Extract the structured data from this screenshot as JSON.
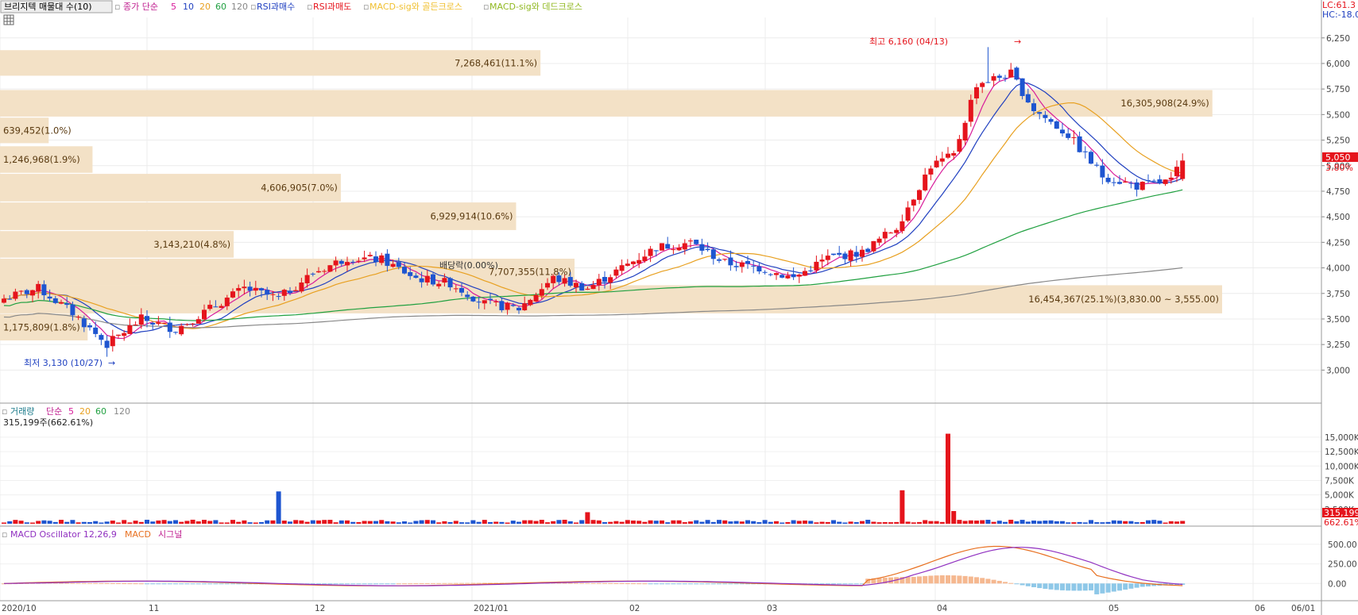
{
  "header": {
    "indicator_button": "브리지텍 매물대 수(10)",
    "ma_label": "종가 단순",
    "ma_periods": [
      "5",
      "10",
      "20",
      "60",
      "120"
    ],
    "rsi_buy": "RSI과매수",
    "rsi_sell": "RSI과매도",
    "macd_golden": "MACD-sig와 골든크로스",
    "macd_dead": "MACD-sig와 데드크로스",
    "lc": "LC:61.3",
    "hc": "HC:-18.0"
  },
  "volume_header": {
    "title": "거래량",
    "ma_label": "단순",
    "periods": [
      "5",
      "20",
      "60",
      "120"
    ],
    "current": "315,199주(662.61%)"
  },
  "macd_header": {
    "title": "MACD Oscillator 12,26,9",
    "macd": "MACD",
    "signal": "시그널"
  },
  "price_badge": {
    "price": "5,050",
    "change": "3.80%"
  },
  "volume_badge": {
    "value": "315,199",
    "pct": "662.61%"
  },
  "annotations": {
    "high": "최고 6,160 (04/13)",
    "low": "최저 3,130 (10/27)",
    "dividend": "배당락(0.00%)"
  },
  "colors": {
    "up": "#e5141c",
    "down": "#1e55d0",
    "ma5": "#d81b9a",
    "ma10": "#2040c0",
    "ma20": "#e8a020",
    "ma60": "#20a040",
    "ma120": "#888888",
    "profile": "#f3e1c6"
  },
  "chart_data": [
    {
      "type": "candlestick",
      "title": "",
      "ylim": [
        2700,
        6450
      ],
      "y_ticks": [
        "3,000",
        "3,250",
        "3,500",
        "3,750",
        "4,000",
        "4,250",
        "4,500",
        "4,750",
        "5,000",
        "5,250",
        "5,500",
        "5,750",
        "6,000",
        "6,250"
      ],
      "x_tick_labels": [
        "2020/10",
        "11",
        "12",
        "2021/01",
        "02",
        "03",
        "04",
        "05",
        "06",
        "06/01"
      ],
      "last_close": 5050,
      "high": 6160,
      "low": 3130,
      "volume_profile": [
        {
          "label": "7,268,461(11.1%)",
          "from": 5880,
          "to": 6130
        },
        {
          "label": "16,305,908(24.9%)",
          "from": 5480,
          "to": 5740
        },
        {
          "label": "639,452(1.0%)",
          "from": 5220,
          "to": 5470
        },
        {
          "label": "1,246,968(1.9%)",
          "from": 4930,
          "to": 5190
        },
        {
          "label": "4,606,905(7.0%)",
          "from": 4650,
          "to": 4920
        },
        {
          "label": "6,929,914(10.6%)",
          "from": 4370,
          "to": 4640
        },
        {
          "label": "3,143,210(4.8%)",
          "from": 4100,
          "to": 4360
        },
        {
          "label": "7,707,355(11.8%)",
          "from": 3830,
          "to": 4090
        },
        {
          "label": "16,454,367(25.1%)(3,830.00 ~ 3,555.00)",
          "from": 3555,
          "to": 3830
        },
        {
          "label": "1,175,809(1.8%)",
          "from": 3290,
          "to": 3550
        }
      ]
    },
    {
      "type": "bar",
      "title": "",
      "y_ticks": [
        "2,500K",
        "5,000K",
        "7,500K",
        "10,000K",
        "12,500K",
        "15,000K"
      ],
      "ylim": [
        0,
        16500
      ]
    },
    {
      "type": "bar",
      "title": "",
      "y_ticks": [
        "0.00",
        "250.00",
        "500.00"
      ],
      "ylim": [
        -200,
        560
      ]
    }
  ]
}
